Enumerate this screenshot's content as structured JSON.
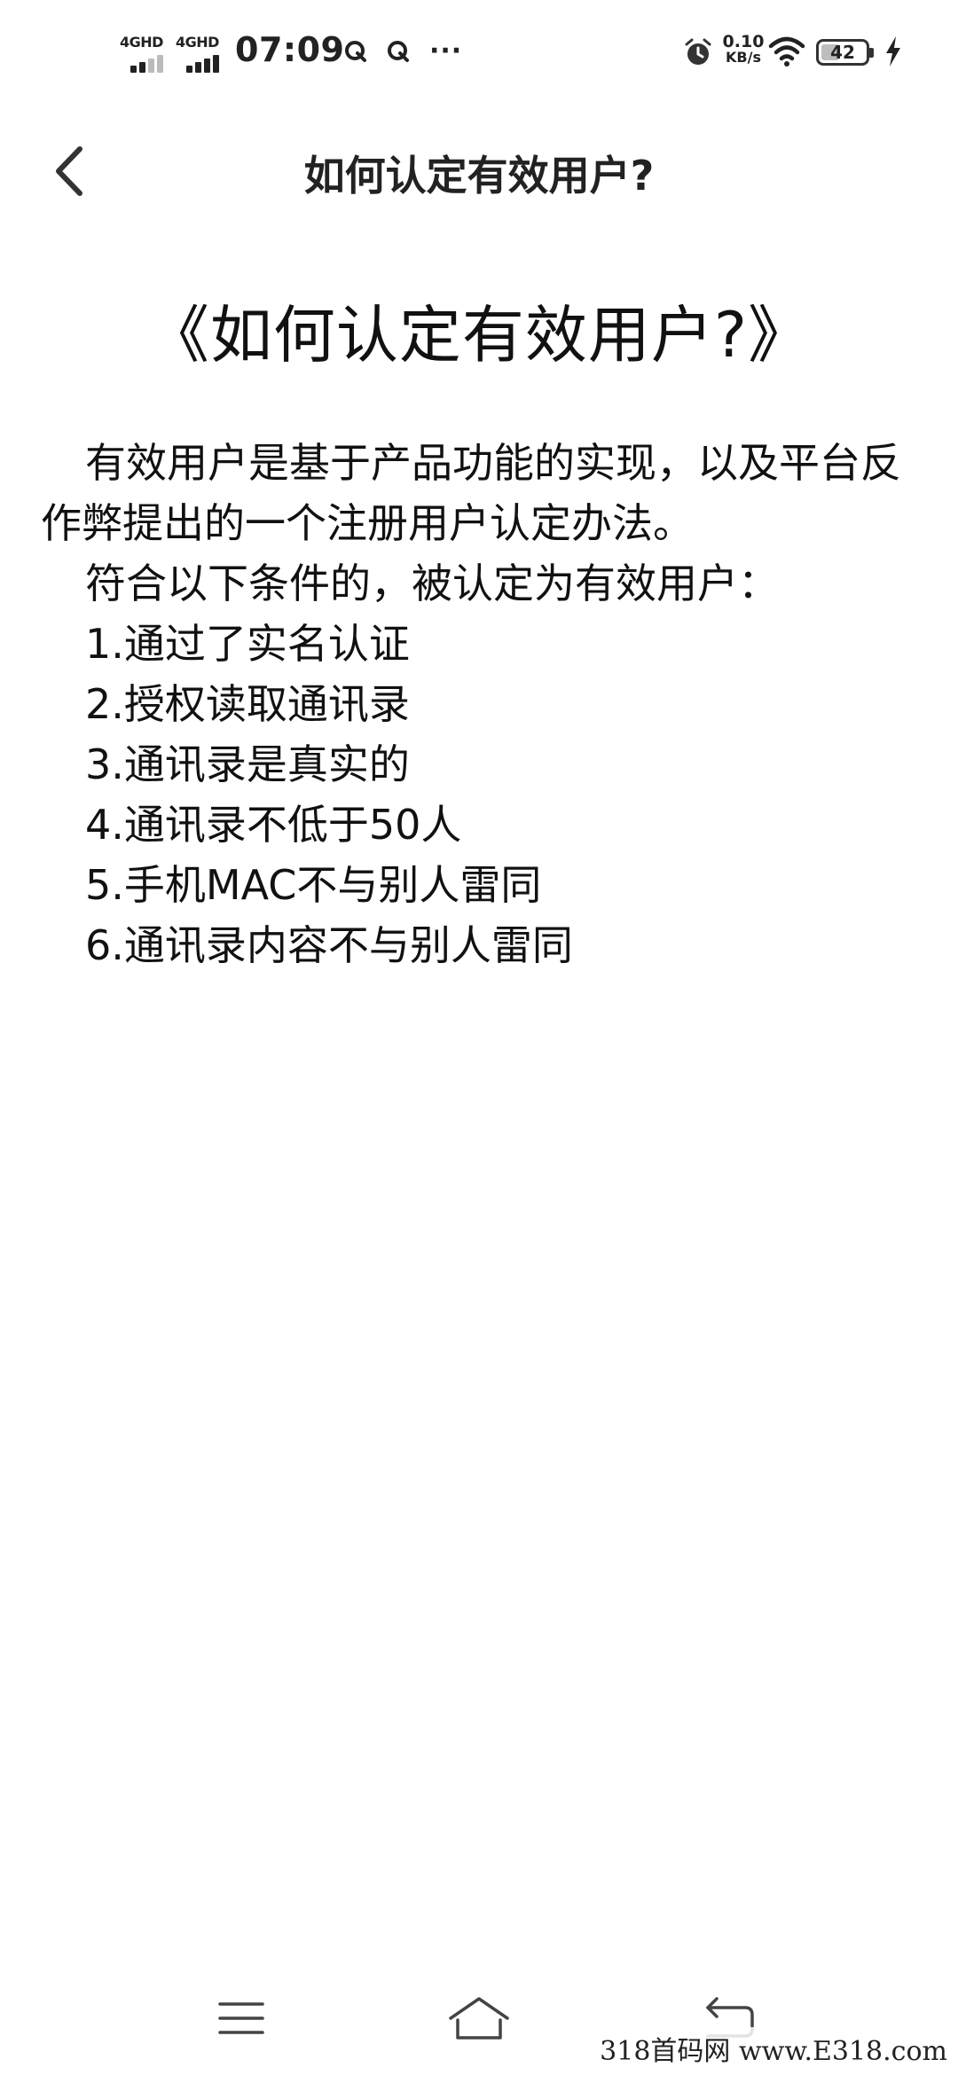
{
  "status_bar": {
    "sim1_network": "4GHD",
    "sim2_network": "4GHD",
    "time": "07:09",
    "more": "···",
    "net_speed_value": "0.10",
    "net_speed_unit": "KB/s",
    "battery_level": "42",
    "icons": [
      "q-app-icon",
      "q-app-icon",
      "alarm-icon",
      "wifi-icon",
      "charging-icon"
    ]
  },
  "header": {
    "title": "如何认定有效用户?"
  },
  "article": {
    "title": "《如何认定有效用户?》",
    "paragraphs": [
      "有效用户是基于产品功能的实现，以及平台反作弊提出的一个注册用户认定办法。",
      "符合以下条件的，被认定为有效用户："
    ],
    "conditions": [
      "1.通过了实名认证",
      "2.授权读取通讯录",
      "3.通讯录是真实的",
      "4.通讯录不低于50人",
      "5.手机MAC不与别人雷同",
      "6.通讯录内容不与别人雷同"
    ]
  },
  "nav_bar": {
    "icons": [
      "menu-icon",
      "home-icon",
      "back-arrow-icon"
    ]
  },
  "watermark": "318首码网 www.E318.com"
}
